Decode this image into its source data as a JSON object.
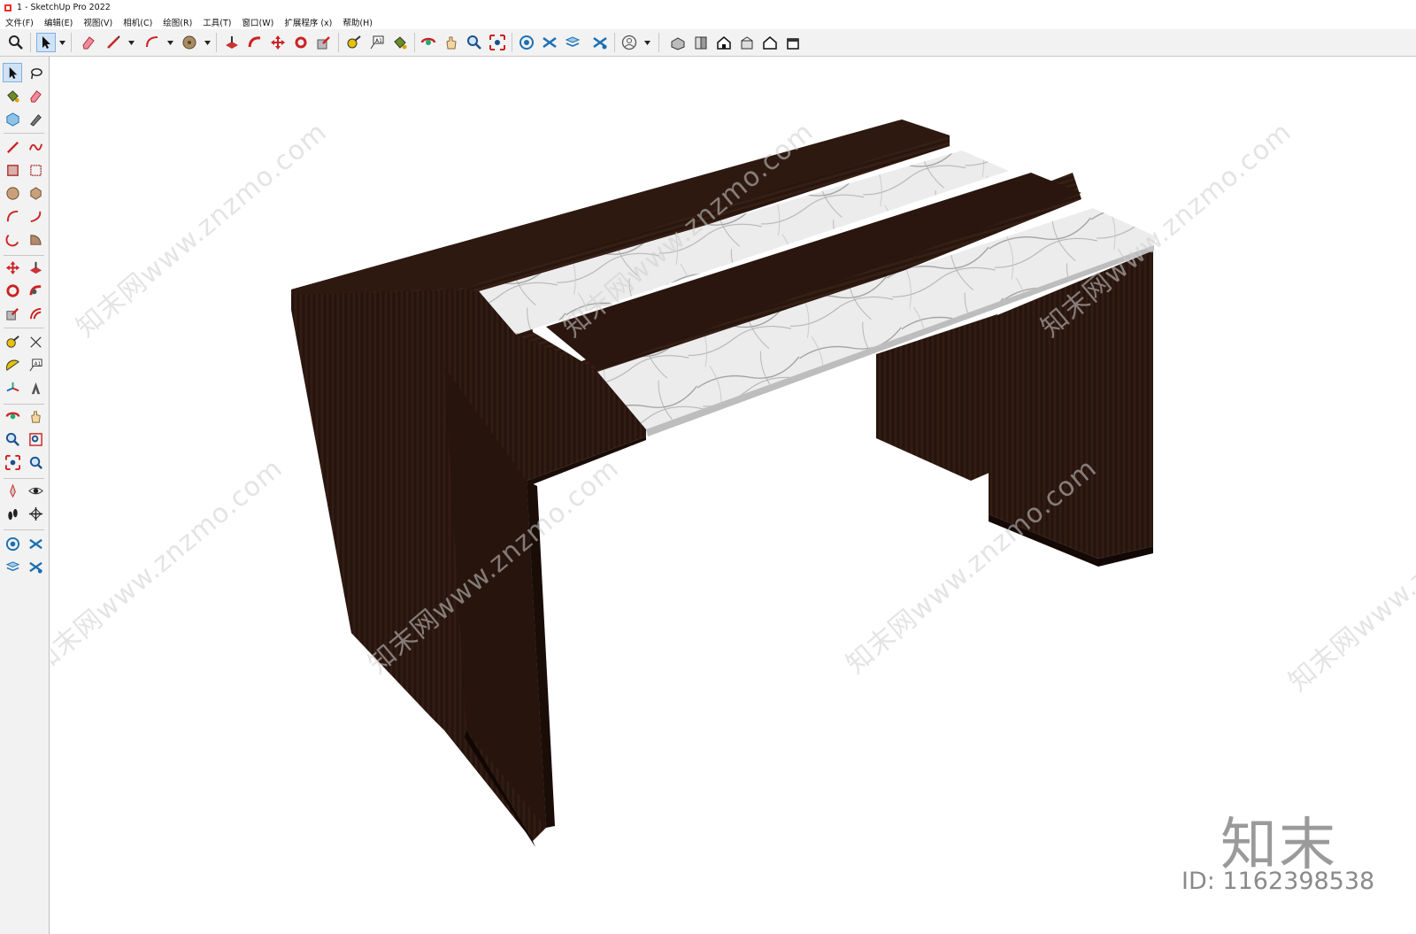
{
  "window": {
    "title": "1 - SketchUp Pro 2022"
  },
  "menu": [
    "文件(F)",
    "编辑(E)",
    "视图(V)",
    "相机(C)",
    "绘图(R)",
    "工具(T)",
    "窗口(W)",
    "扩展程序 (x)",
    "帮助(H)"
  ],
  "toolbar_icons": [
    "zoom-icon",
    "select-icon",
    "eraser-icon",
    "line-icon",
    "arc-icon",
    "paint-icon",
    "pushpull-icon",
    "followme-icon",
    "move-icon",
    "rotate-icon",
    "scale-icon",
    "tape-icon",
    "text-icon",
    "paint-bucket-icon",
    "orbit-icon",
    "pan-icon",
    "zoom-tool-icon",
    "zoom-extents-icon",
    "warehouse-icon",
    "extension-icon",
    "layers-icon",
    "components-icon",
    "account-icon",
    "iso-view-icon",
    "front-view-icon",
    "top-view-icon",
    "side-view-icon",
    "home-view-icon",
    "back-view-icon"
  ],
  "watermark": {
    "text": "知末网www.znzmo.com",
    "logo": "知末",
    "id": "ID: 1162398538"
  },
  "colors": {
    "wood": "#2b1710",
    "wood_dark": "#1d0f0a",
    "marble": "#e6e6e6",
    "toolbar_bg": "#f2f2f2",
    "accent": "#cfe3f7"
  }
}
